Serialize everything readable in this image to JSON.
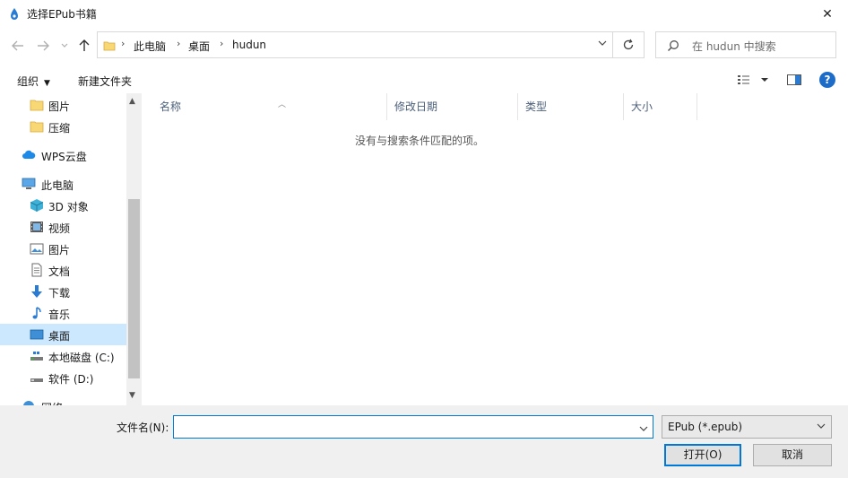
{
  "window": {
    "title": "选择EPub书籍",
    "close_glyph": "✕"
  },
  "address": {
    "crumbs": [
      "此电脑",
      "桌面",
      "hudun"
    ],
    "separator": "›"
  },
  "search": {
    "placeholder": "在 hudun 中搜索"
  },
  "toolbar": {
    "organize": "组织",
    "new_folder": "新建文件夹",
    "help": "?"
  },
  "sidebar": {
    "items": [
      {
        "label": "图片",
        "icon": "folder-icon"
      },
      {
        "label": "压缩",
        "icon": "folder-icon"
      },
      {
        "label": "WPS云盘",
        "icon": "cloud-icon"
      },
      {
        "label": "此电脑",
        "icon": "computer-icon"
      },
      {
        "label": "3D 对象",
        "icon": "cube-icon"
      },
      {
        "label": "视频",
        "icon": "video-icon"
      },
      {
        "label": "图片",
        "icon": "picture-icon"
      },
      {
        "label": "文档",
        "icon": "document-icon"
      },
      {
        "label": "下载",
        "icon": "download-icon"
      },
      {
        "label": "音乐",
        "icon": "music-icon"
      },
      {
        "label": "桌面",
        "icon": "desktop-icon",
        "selected": true
      },
      {
        "label": "本地磁盘 (C:)",
        "icon": "drive-icon"
      },
      {
        "label": "软件 (D:)",
        "icon": "drive-icon"
      },
      {
        "label": "网络",
        "icon": "network-icon"
      }
    ]
  },
  "filelist": {
    "columns": [
      "名称",
      "修改日期",
      "类型",
      "大小"
    ],
    "empty_message": "没有与搜索条件匹配的项。"
  },
  "bottom": {
    "filename_label": "文件名(N):",
    "filename_value": "",
    "filter_value": "EPub (*.epub)",
    "open_label": "打开(O)",
    "cancel_label": "取消"
  },
  "colors": {
    "accent": "#0078d7",
    "selection": "#cce8ff",
    "folder": "#f8d775"
  }
}
